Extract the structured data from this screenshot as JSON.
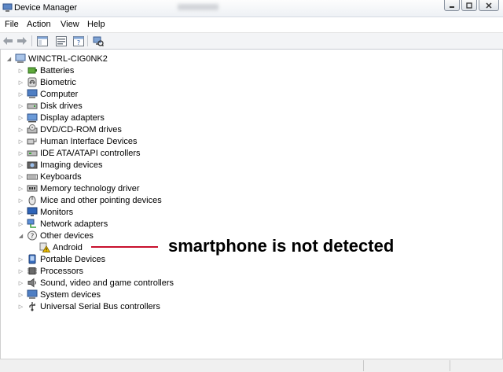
{
  "window": {
    "title": "Device Manager"
  },
  "menu": [
    "File",
    "Action",
    "View",
    "Help"
  ],
  "tree": {
    "root": "WINCTRL-CIG0NK2",
    "categories": [
      {
        "label": "Batteries",
        "icon": "battery-icon"
      },
      {
        "label": "Biometric",
        "icon": "fingerprint-icon"
      },
      {
        "label": "Computer",
        "icon": "computer-icon"
      },
      {
        "label": "Disk drives",
        "icon": "disk-drive-icon"
      },
      {
        "label": "Display adapters",
        "icon": "display-adapter-icon"
      },
      {
        "label": "DVD/CD-ROM drives",
        "icon": "dvd-drive-icon"
      },
      {
        "label": "Human Interface Devices",
        "icon": "hid-icon"
      },
      {
        "label": "IDE ATA/ATAPI controllers",
        "icon": "ide-controller-icon"
      },
      {
        "label": "Imaging devices",
        "icon": "camera-icon"
      },
      {
        "label": "Keyboards",
        "icon": "keyboard-icon"
      },
      {
        "label": "Memory technology driver",
        "icon": "memory-icon"
      },
      {
        "label": "Mice and other pointing devices",
        "icon": "mouse-icon"
      },
      {
        "label": "Monitors",
        "icon": "monitor-icon"
      },
      {
        "label": "Network adapters",
        "icon": "network-icon"
      },
      {
        "label": "Other devices",
        "icon": "unknown-device-icon",
        "expanded": true,
        "children": [
          {
            "label": "Android",
            "icon": "warning-device-icon"
          }
        ]
      },
      {
        "label": "Portable Devices",
        "icon": "portable-device-icon"
      },
      {
        "label": "Processors",
        "icon": "processor-icon"
      },
      {
        "label": "Sound, video and game controllers",
        "icon": "speaker-icon"
      },
      {
        "label": "System devices",
        "icon": "system-device-icon"
      },
      {
        "label": "Universal Serial Bus controllers",
        "icon": "usb-icon"
      }
    ]
  },
  "annotation": {
    "text": "smartphone is not detected",
    "color": "#c8102e"
  }
}
